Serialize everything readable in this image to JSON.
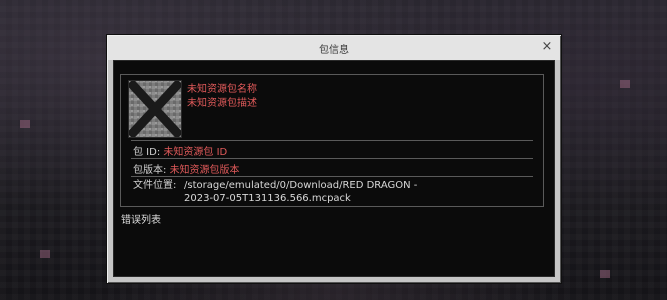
{
  "dialog": {
    "title": "包信息",
    "close_glyph": "×"
  },
  "pack": {
    "icon": "unknown-pack-icon",
    "name": "未知资源包名称",
    "description": "未知资源包描述"
  },
  "details": {
    "id_label": "包 ID:",
    "id_value": "未知资源包 ID",
    "version_label": "包版本:",
    "version_value": "未知资源包版本",
    "location_label": "文件位置:",
    "location_value": "/storage/emulated/0/Download/RED DRAGON - 2023-07-05T131136.566.mcpack"
  },
  "errors": {
    "label": "错误列表"
  },
  "colors": {
    "error_text": "#e15a5a",
    "panel_bg": "#0b0b0b",
    "frame": "#c6c6c6"
  }
}
